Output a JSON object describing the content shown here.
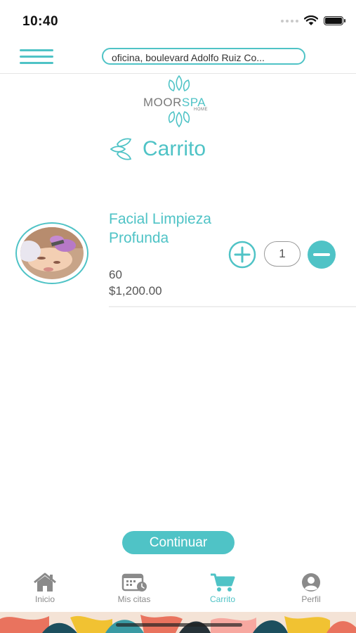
{
  "status_bar": {
    "time": "10:40"
  },
  "header": {
    "address": "oficina, boulevard Adolfo Ruiz Co..."
  },
  "logo": {
    "brand_main": "MOOR",
    "brand_accent": "SPA",
    "brand_sub": "HOME"
  },
  "page": {
    "title": "Carrito"
  },
  "cart": {
    "items": [
      {
        "name": "Facial Limpieza Profunda",
        "duration": "60",
        "price": "$1,200.00",
        "quantity": "1"
      }
    ]
  },
  "actions": {
    "continue_label": "Continuar"
  },
  "tabs": [
    {
      "label": "Inicio",
      "icon": "home-icon"
    },
    {
      "label": "Mis citas",
      "icon": "calendar-clock-icon"
    },
    {
      "label": "Carrito",
      "icon": "cart-icon",
      "active": true
    },
    {
      "label": "Perfil",
      "icon": "user-icon"
    }
  ],
  "colors": {
    "accent": "#4fc3c6",
    "text_dark": "#555555",
    "tab_inactive": "#8a8a8a"
  }
}
